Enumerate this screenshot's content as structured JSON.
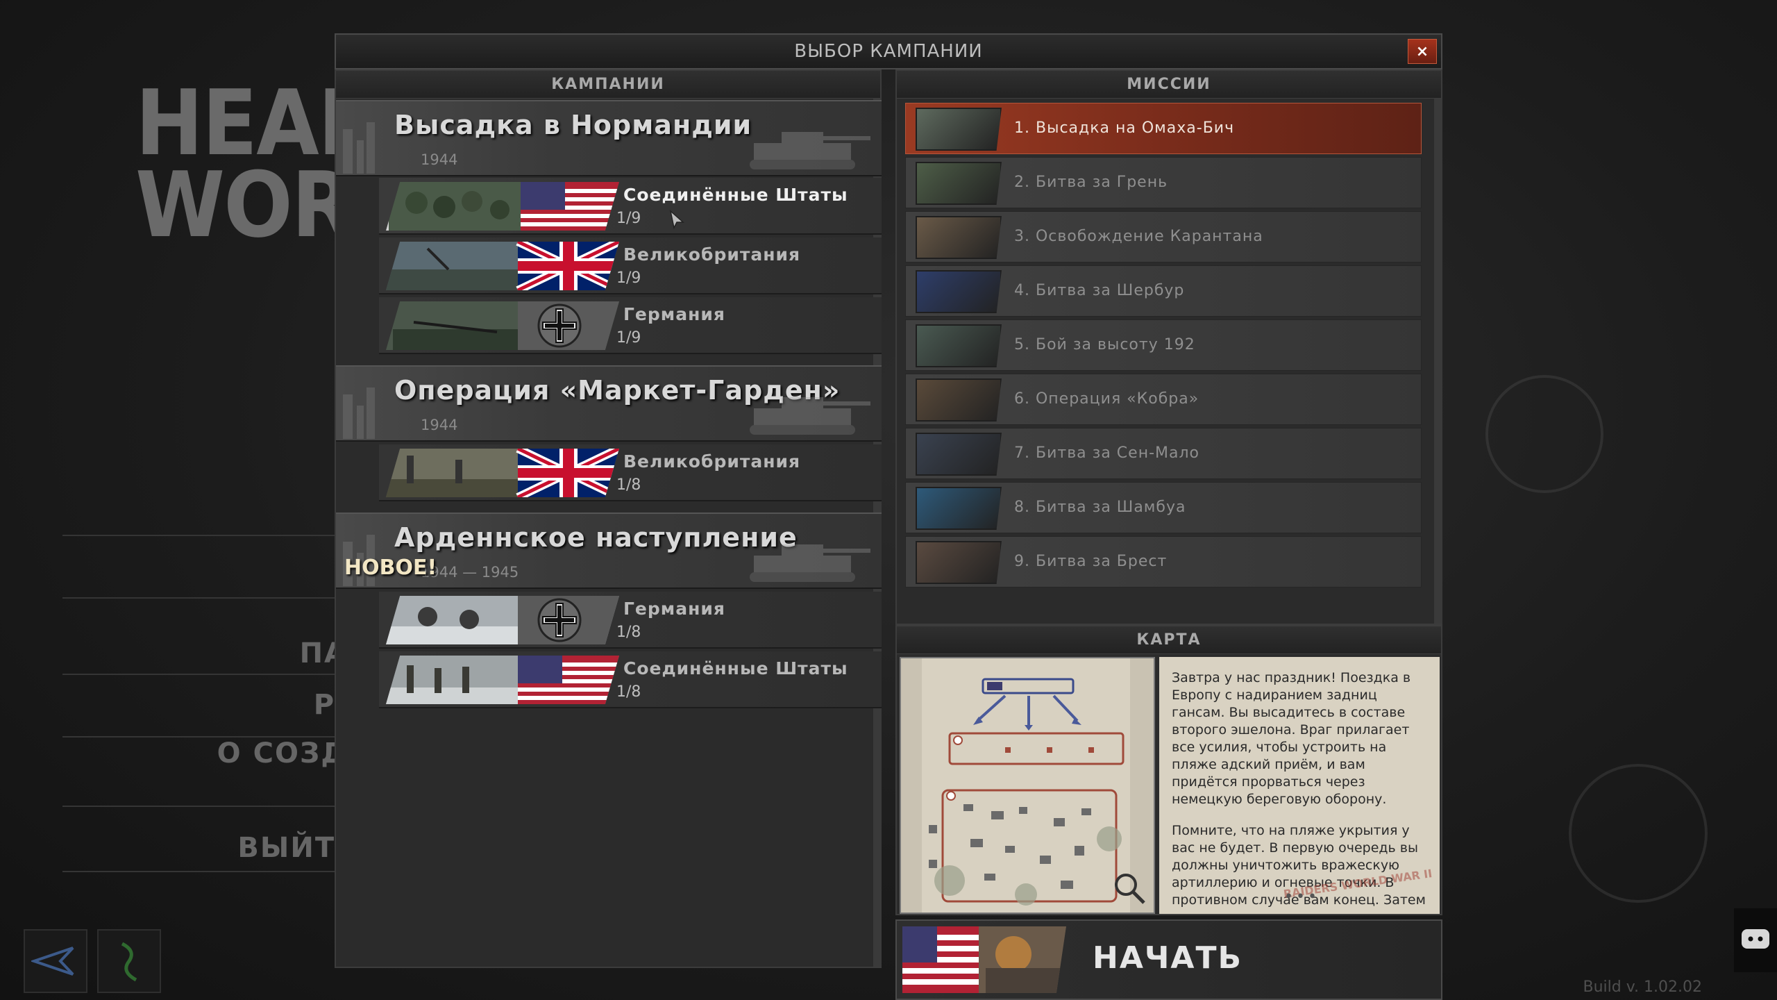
{
  "background": {
    "logo_line1": "HEAD",
    "logo_line2": "WOR",
    "menu_items": [
      "ПА",
      "РІ",
      "О СОЗД",
      "ВЫЙТІ"
    ],
    "build": "Build v. 1.02.02"
  },
  "dialog": {
    "title": "ВЫБОР КАМПАНИИ",
    "close_label": "×"
  },
  "campaigns": {
    "header": "КАМПАНИИ",
    "items": [
      {
        "name": "Высадка в Нормандии",
        "year": "1944",
        "factions": [
          {
            "name": "Соединённые Штаты",
            "progress": "1/9",
            "flag": "usa",
            "selected": true
          },
          {
            "name": "Великобритания",
            "progress": "1/9",
            "flag": "uk",
            "selected": false
          },
          {
            "name": "Германия",
            "progress": "1/9",
            "flag": "germany",
            "selected": false
          }
        ]
      },
      {
        "name": "Операция «Маркет-Гарден»",
        "year": "1944",
        "factions": [
          {
            "name": "Великобритания",
            "progress": "1/8",
            "flag": "uk",
            "selected": false
          }
        ]
      },
      {
        "name": "Арденнское наступление",
        "year": "1944 — 1945",
        "badge": "НОВОЕ!",
        "factions": [
          {
            "name": "Германия",
            "progress": "1/8",
            "flag": "germany",
            "selected": false
          },
          {
            "name": "Соединённые Штаты",
            "progress": "1/8",
            "flag": "usa",
            "selected": false
          }
        ]
      }
    ]
  },
  "missions": {
    "header": "МИССИИ",
    "items": [
      {
        "label": "1. Высадка на Омаха-Бич",
        "selected": true
      },
      {
        "label": "2. Битва за Грень",
        "selected": false
      },
      {
        "label": "3. Освобождение Карантана",
        "selected": false
      },
      {
        "label": "4. Битва за Шербур",
        "selected": false
      },
      {
        "label": "5. Бой за высоту 192",
        "selected": false
      },
      {
        "label": "6. Операция «Кобра»",
        "selected": false
      },
      {
        "label": "7. Битва за Сен-Мало",
        "selected": false
      },
      {
        "label": "8. Битва за Шамбуа",
        "selected": false
      },
      {
        "label": "9. Битва за Брест",
        "selected": false
      }
    ]
  },
  "map": {
    "header": "КАРТА",
    "briefing_p1": "Завтра у нас праздник! Поездка в Европу с надиранием задниц гансам. Вы высадитесь в составе второго эшелона. Враг прилагает все усилия, чтобы устроить на пляже адский приём, и вам придётся прорваться через немецкую береговую оборону.",
    "briefing_p2": "Помните, что на пляже укрытия у вас не будет. В первую очередь вы должны уничтожить вражескую артиллерию и огневые точки. В противном случае вам конец. Затем",
    "more": "•••",
    "stamp": "RAIDERS WORLD WAR II"
  },
  "start": {
    "label": "НАЧАТЬ"
  },
  "colors": {
    "accent": "#8a3420",
    "panel": "#2b2b2b"
  }
}
